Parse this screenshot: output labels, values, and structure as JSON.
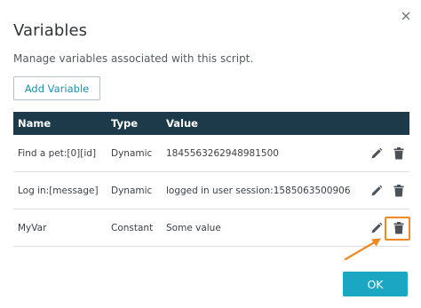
{
  "dialog": {
    "title": "Variables",
    "subtitle": "Manage variables associated with this script.",
    "add_button_label": "Add Variable",
    "ok_button_label": "OK",
    "close_icon": "close-icon"
  },
  "table": {
    "headers": {
      "name": "Name",
      "type": "Type",
      "value": "Value"
    },
    "rows": [
      {
        "name": "Find a pet:[0][id]",
        "type": "Dynamic",
        "value": "1845563262948981500"
      },
      {
        "name": "Log in:[message]",
        "type": "Dynamic",
        "value": "logged in user session:1585063500906"
      },
      {
        "name": "MyVar",
        "type": "Constant",
        "value": "Some value"
      }
    ],
    "row_actions": [
      "pencil-icon",
      "trash-icon"
    ]
  },
  "annotation": {
    "highlight_color": "#ef8a23",
    "target": "delete-button of row MyVar"
  },
  "colors": {
    "header_bg": "#1c3a4a",
    "accent": "#1ba7c4",
    "link": "#1f8fb0"
  }
}
